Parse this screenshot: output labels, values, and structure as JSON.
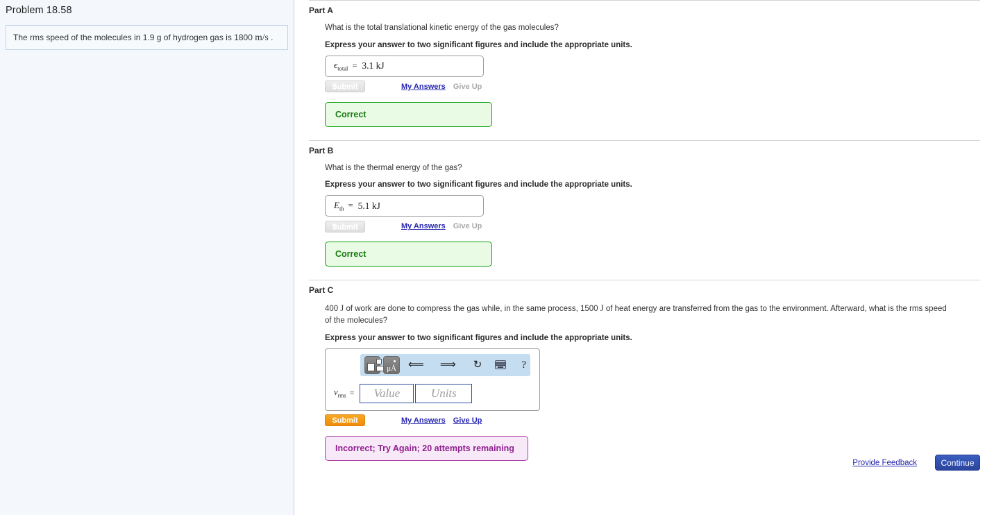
{
  "sidebar": {
    "problem_title": "Problem 18.58",
    "statement_prefix": "The rms speed of the molecules in 1.9 g of hydrogen gas is 1800",
    "statement_unit": "m/s",
    "statement_suffix": "."
  },
  "parts": [
    {
      "label": "Part A",
      "question": "What is the total translational kinetic energy of the gas molecules?",
      "instruction": "Express your answer to two significant figures and include the appropriate units.",
      "answer_symbol": "ϵ",
      "answer_subscript": "total",
      "equals": "=",
      "answer_value": "3.1 kJ",
      "submit_label": "Submit",
      "my_answers_label": "My Answers",
      "give_up_label": "Give Up",
      "feedback": "Correct"
    },
    {
      "label": "Part B",
      "question": "What is the thermal energy of the gas?",
      "instruction": "Express your answer to two significant figures and include the appropriate units.",
      "answer_symbol": "E",
      "answer_subscript": "th",
      "equals": "=",
      "answer_value": "5.1 kJ",
      "submit_label": "Submit",
      "my_answers_label": "My Answers",
      "give_up_label": "Give Up",
      "feedback": "Correct"
    },
    {
      "label": "Part C",
      "question_part1": "400",
      "question_unit1": "J",
      "question_part2": "of work are done to compress the gas while, in the same process, 1500",
      "question_unit2": "J",
      "question_part3": "of heat energy are transferred from the gas to the environment. Afterward, what is the rms speed of the molecules?",
      "instruction": "Express your answer to two significant figures and include the appropriate units.",
      "answer_symbol": "v",
      "answer_subscript": "rms",
      "equals": "=",
      "value_placeholder": "Value",
      "units_placeholder": "Units",
      "submit_label": "Submit",
      "my_answers_label": "My Answers",
      "give_up_label": "Give Up",
      "feedback": "Incorrect; Try Again; 20 attempts remaining",
      "toolbar": {
        "template_icon": "template-tile-icon",
        "units_icon_label": "μÅ",
        "undo_icon": "⬅",
        "redo_icon": "➡",
        "reset_icon": "↻",
        "keyboard_icon": "keyboard-icon",
        "help_icon": "?"
      }
    }
  ],
  "footer": {
    "provide_feedback_label": "Provide Feedback",
    "continue_label": "Continue"
  },
  "colors": {
    "correct_border": "#11a011",
    "correct_bg": "#e9fbe4",
    "correct_text": "#1a7a14",
    "incorrect_border": "#a93fa9",
    "incorrect_bg": "#f8e9f8",
    "incorrect_text": "#8f1f8f",
    "submit_active": "#ef8c0b",
    "link_blue": "#2727b0",
    "continue_blue": "#2a459d",
    "toolbar_blue": "#c5ddf0",
    "sidebar_bg": "#f4f8fd"
  }
}
